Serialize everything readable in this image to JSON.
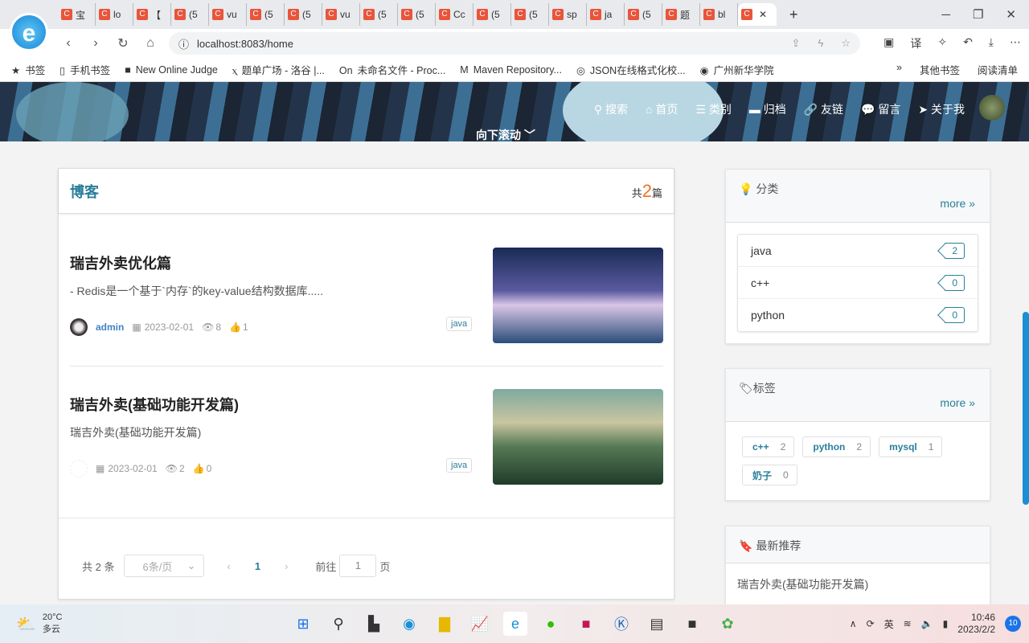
{
  "browser": {
    "tabs": [
      "宝",
      "lo",
      "【",
      "(5",
      "vu",
      "(5",
      "(5",
      "vu",
      "(5",
      "(5",
      "Cc",
      "(5",
      "(5",
      "sp",
      "ja",
      "(5",
      "题",
      "bl",
      ""
    ],
    "url": "localhost:8083/home",
    "bookmarks": [
      "书签",
      "手机书签",
      "New Online Judge",
      "题单广场 - 洛谷 |...",
      "未命名文件 - Proc...",
      "Maven Repository...",
      "JSON在线格式化校...",
      "广州新华学院"
    ],
    "bookmarks_right": [
      "»",
      "其他书签",
      "阅读清单"
    ]
  },
  "site": {
    "nav": [
      {
        "icon": "search-icon",
        "label": "搜索"
      },
      {
        "icon": "home-icon",
        "label": "首页"
      },
      {
        "icon": "list-icon",
        "label": "类别"
      },
      {
        "icon": "archive-icon",
        "label": "归档"
      },
      {
        "icon": "link-icon",
        "label": "友链"
      },
      {
        "icon": "comment-icon",
        "label": "留言"
      },
      {
        "icon": "send-icon",
        "label": "关于我"
      }
    ],
    "scroll_hint": "向下滚动",
    "blog": {
      "title": "博客",
      "count_prefix": "共",
      "count": "2",
      "count_suffix": "篇",
      "posts": [
        {
          "title": "瑞吉外卖优化篇",
          "excerpt": "- Redis是一个基于`内存`的key-value结构数据库.....",
          "author": "admin",
          "date": "2023-02-01",
          "views": "8",
          "likes": "1",
          "tag": "java"
        },
        {
          "title": "瑞吉外卖(基础功能开发篇)",
          "excerpt": "瑞吉外卖(基础功能开发篇)",
          "author": "",
          "date": "2023-02-01",
          "views": "2",
          "likes": "0",
          "tag": "java"
        }
      ]
    },
    "pagination": {
      "total": "共 2 条",
      "page_size": "6条/页",
      "current": "1",
      "goto_label": "前往",
      "goto_value": "1",
      "page_suffix": "页"
    },
    "categories": {
      "title": "分类",
      "more": "more",
      "items": [
        {
          "name": "java",
          "count": "2"
        },
        {
          "name": "c++",
          "count": "0"
        },
        {
          "name": "python",
          "count": "0"
        }
      ]
    },
    "tags": {
      "title": "标签",
      "more": "more",
      "items": [
        {
          "name": "c++",
          "count": "2"
        },
        {
          "name": "python",
          "count": "2"
        },
        {
          "name": "mysql",
          "count": "1"
        },
        {
          "name": "奶子",
          "count": "0"
        }
      ]
    },
    "recommend": {
      "title": "最新推荐",
      "items": [
        "瑞吉外卖(基础功能开发篇)"
      ]
    }
  },
  "taskbar": {
    "temp": "20°C",
    "weather": "多云",
    "ime": "英",
    "time": "10:46",
    "date": "2023/2/2",
    "notifications": "10"
  },
  "colors": {
    "accent": "#2a7e9a",
    "count": "#f2711c"
  }
}
